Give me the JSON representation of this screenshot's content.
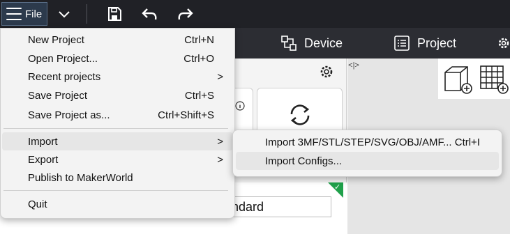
{
  "toolbar": {
    "file_label": "File"
  },
  "tabs": [
    {
      "label": "Device",
      "icon": "device-icon"
    },
    {
      "label": "Project",
      "icon": "project-icon"
    }
  ],
  "file_menu": {
    "items": [
      {
        "label": "New Project",
        "shortcut": "Ctrl+N"
      },
      {
        "label": "Open Project...",
        "shortcut": "Ctrl+O"
      },
      {
        "label": "Recent projects",
        "submenu": ">"
      },
      {
        "label": "Save Project",
        "shortcut": "Ctrl+S"
      },
      {
        "label": "Save Project as...",
        "shortcut": "Ctrl+Shift+S"
      },
      {
        "label": "Import",
        "submenu": ">"
      },
      {
        "label": "Export",
        "submenu": ">"
      },
      {
        "label": "Publish to MakerWorld"
      },
      {
        "label": "Quit"
      }
    ]
  },
  "import_submenu": {
    "items": [
      {
        "label": "Import 3MF/STL/STEP/SVG/OBJ/AMF...",
        "shortcut": "Ctrl+I"
      },
      {
        "label": "Import Configs..."
      }
    ]
  },
  "panel": {
    "plate_type_value": "tandard"
  },
  "colors": {
    "toolbar_bg": "#202126",
    "tabbar_bg": "#2c2d33",
    "accent_green": "#1fa04a"
  }
}
